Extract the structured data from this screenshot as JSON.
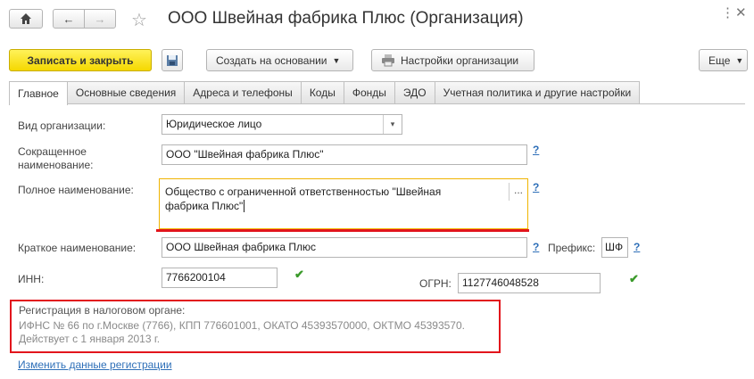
{
  "window": {
    "title": "ООО Швейная фабрика Плюс (Организация)",
    "icons": {
      "home": "home-icon",
      "back": "arrow-left-icon",
      "forward": "arrow-right-icon",
      "favorite": "star-icon",
      "more": "kebab-icon",
      "close": "close-icon"
    }
  },
  "toolbar": {
    "save_close": "Записать и закрыть",
    "create_based": "Создать на основании",
    "settings": "Настройки организации",
    "more": "Еще"
  },
  "tabs": [
    "Главное",
    "Основные сведения",
    "Адреса и телефоны",
    "Коды",
    "Фонды",
    "ЭДО",
    "Учетная политика и другие настройки"
  ],
  "form": {
    "org_type_label": "Вид организации:",
    "org_type_value": "Юридическое лицо",
    "short_name_label_1": "Сокращенное",
    "short_name_label_2": "наименование:",
    "short_name_value": "ООО \"Швейная фабрика Плюс\"",
    "full_name_label": "Полное наименование:",
    "full_name_line1": "Общество с ограниченной ответственностью \"Швейная",
    "full_name_line2": "фабрика Плюс\"",
    "brief_name_label": "Краткое наименование:",
    "brief_name_value": "ООО Швейная фабрика Плюс",
    "prefix_label": "Префикс:",
    "prefix_value": "ШФ",
    "inn_label": "ИНН:",
    "inn_value": "7766200104",
    "ogrn_label": "ОГРН:",
    "ogrn_value": "1127746048528",
    "help": "?",
    "ellipsis": "...",
    "dropdown_arrow": "▾"
  },
  "registration": {
    "label": "Регистрация в налоговом органе:",
    "line1": "ИФНС № 66 по г.Москве (7766), КПП 776601001, ОКАТО 45393570000, ОКТМО 45393570.",
    "line2": "Действует с 1 января 2013 г.",
    "change_link": "Изменить данные регистрации"
  },
  "colors": {
    "accent_yellow": "#f5d800",
    "highlight_red": "#e2151c",
    "field_focus_orange": "#f0b400",
    "link_blue": "#2e6fb8",
    "check_green": "#3a9a2a"
  }
}
